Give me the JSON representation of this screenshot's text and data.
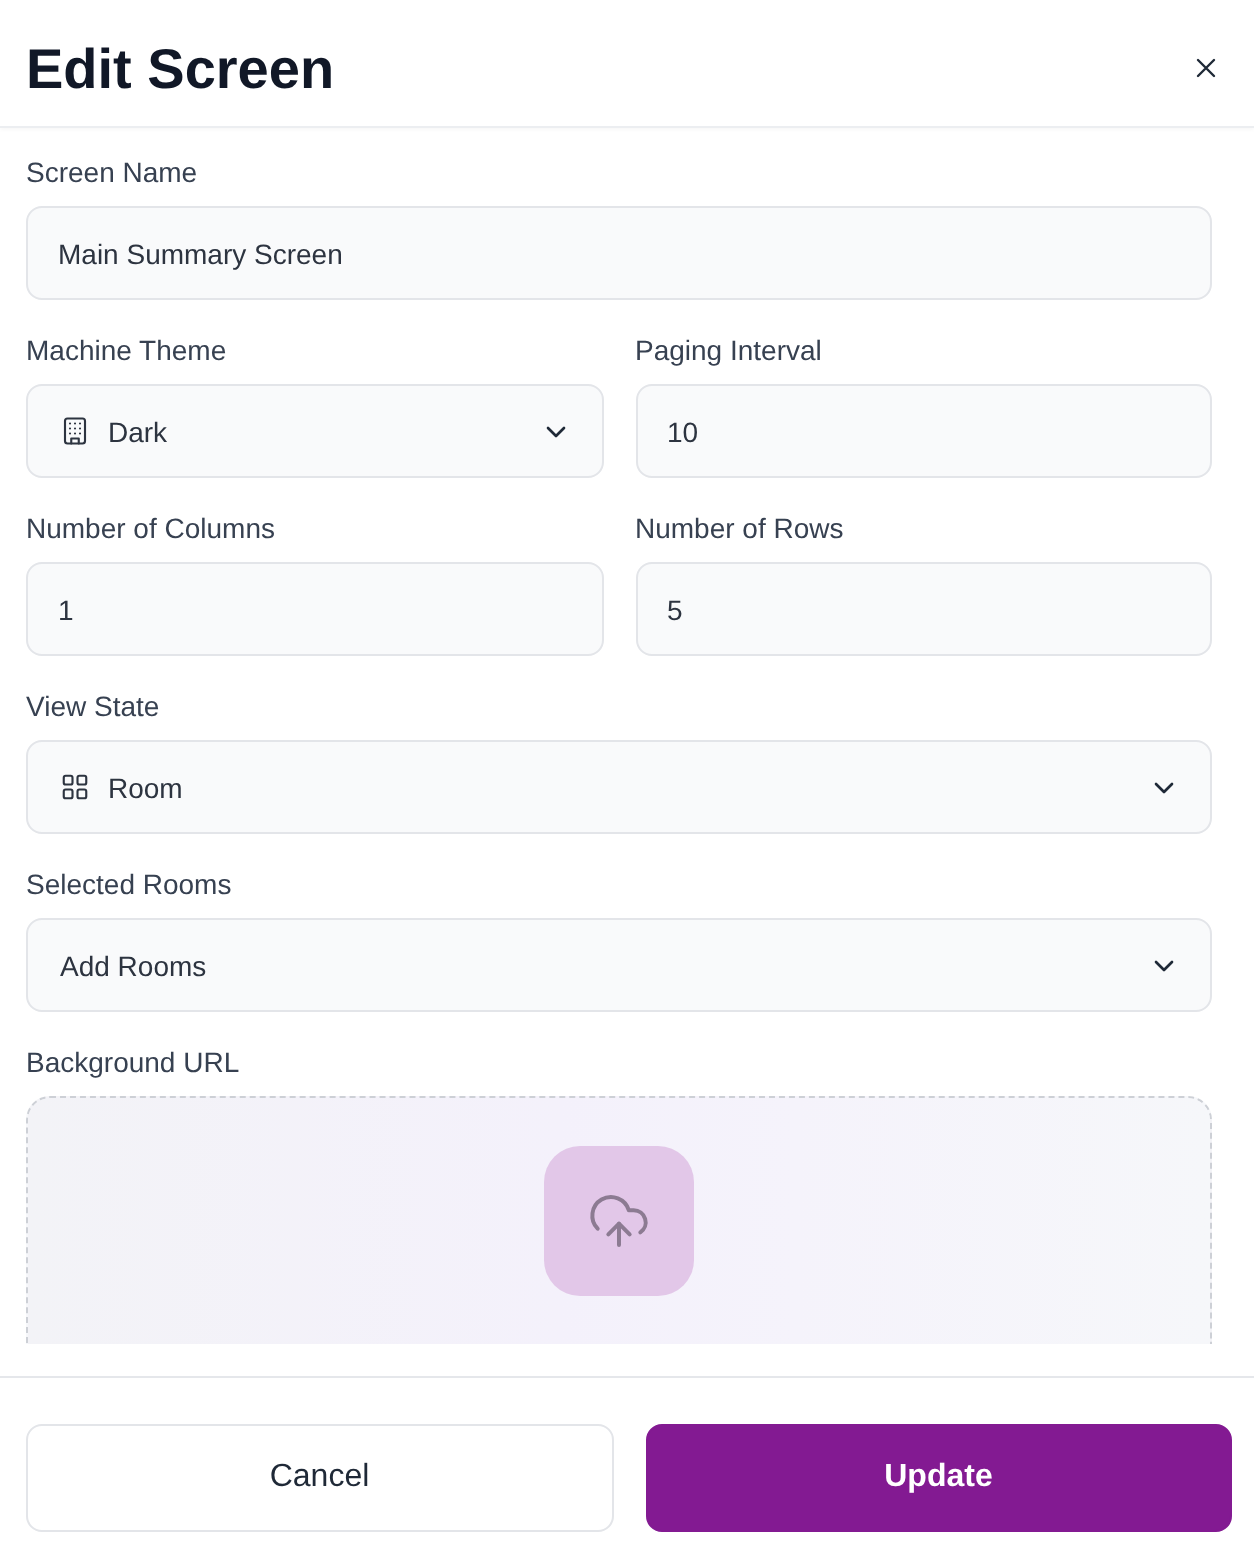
{
  "dialog": {
    "title": "Edit Screen"
  },
  "form_rows": [
    [
      {
        "kind": "text",
        "label": "Screen Name",
        "value": "Main Summary Screen"
      }
    ],
    [
      {
        "kind": "select",
        "label": "Machine Theme",
        "value": "Dark"
      },
      {
        "kind": "text",
        "label": "Paging Interval",
        "value": "10"
      }
    ],
    [
      {
        "kind": "text",
        "label": "Number of Columns",
        "value": "1"
      },
      {
        "kind": "text",
        "label": "Number of Rows",
        "value": "5"
      }
    ],
    [
      {
        "kind": "select",
        "label": "View State",
        "value": "Room"
      }
    ],
    [
      {
        "kind": "select",
        "label": "Selected Rooms",
        "placeholder": "Add Rooms"
      }
    ],
    [
      {
        "kind": "upload",
        "label": "Background URL"
      }
    ]
  ],
  "buttons": [
    {
      "kind": "secondary",
      "label": "Cancel"
    },
    {
      "kind": "primary",
      "label": "Update"
    }
  ]
}
